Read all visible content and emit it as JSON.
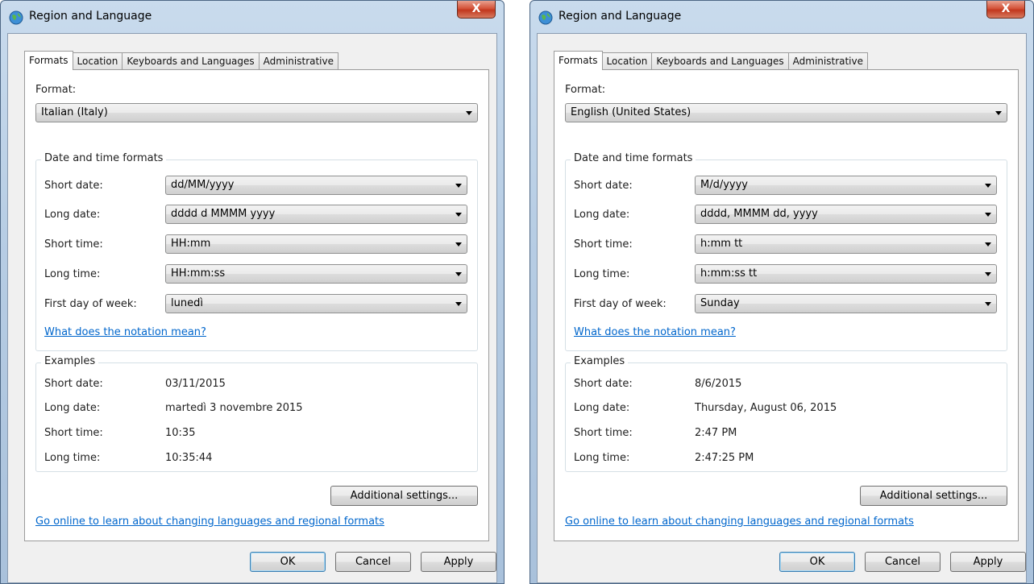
{
  "windows": [
    {
      "title": "Region and Language",
      "close_glyph": "X",
      "tabs": [
        "Formats",
        "Location",
        "Keyboards and Languages",
        "Administrative"
      ],
      "format_label": "Format:",
      "format_value": "Italian (Italy)",
      "dt_group_title": "Date and time formats",
      "rows": [
        {
          "label": "Short date:",
          "value": "dd/MM/yyyy"
        },
        {
          "label": "Long date:",
          "value": "dddd d MMMM yyyy"
        },
        {
          "label": "Short time:",
          "value": "HH:mm"
        },
        {
          "label": "Long time:",
          "value": "HH:mm:ss"
        },
        {
          "label": "First day of week:",
          "value": "lunedì"
        }
      ],
      "notation_link": "What does the notation mean?",
      "examples_title": "Examples",
      "examples": [
        {
          "label": "Short date:",
          "value": "03/11/2015"
        },
        {
          "label": "Long date:",
          "value": "martedì 3 novembre 2015"
        },
        {
          "label": "Short time:",
          "value": "10:35"
        },
        {
          "label": "Long time:",
          "value": "10:35:44"
        }
      ],
      "additional_settings": "Additional settings...",
      "online_link": "Go online to learn about changing languages and regional formats",
      "ok": "OK",
      "cancel": "Cancel",
      "apply": "Apply"
    },
    {
      "title": "Region and Language",
      "close_glyph": "X",
      "tabs": [
        "Formats",
        "Location",
        "Keyboards and Languages",
        "Administrative"
      ],
      "format_label": "Format:",
      "format_value": "English (United States)",
      "dt_group_title": "Date and time formats",
      "rows": [
        {
          "label": "Short date:",
          "value": "M/d/yyyy"
        },
        {
          "label": "Long date:",
          "value": "dddd, MMMM dd, yyyy"
        },
        {
          "label": "Short time:",
          "value": "h:mm tt"
        },
        {
          "label": "Long time:",
          "value": "h:mm:ss tt"
        },
        {
          "label": "First day of week:",
          "value": "Sunday"
        }
      ],
      "notation_link": "What does the notation mean?",
      "examples_title": "Examples",
      "examples": [
        {
          "label": "Short date:",
          "value": "8/6/2015"
        },
        {
          "label": "Long date:",
          "value": "Thursday, August 06, 2015"
        },
        {
          "label": "Short time:",
          "value": "2:47 PM"
        },
        {
          "label": "Long time:",
          "value": "2:47:25 PM"
        }
      ],
      "additional_settings": "Additional settings...",
      "online_link": "Go online to learn about changing languages and regional formats",
      "ok": "OK",
      "cancel": "Cancel",
      "apply": "Apply"
    }
  ]
}
